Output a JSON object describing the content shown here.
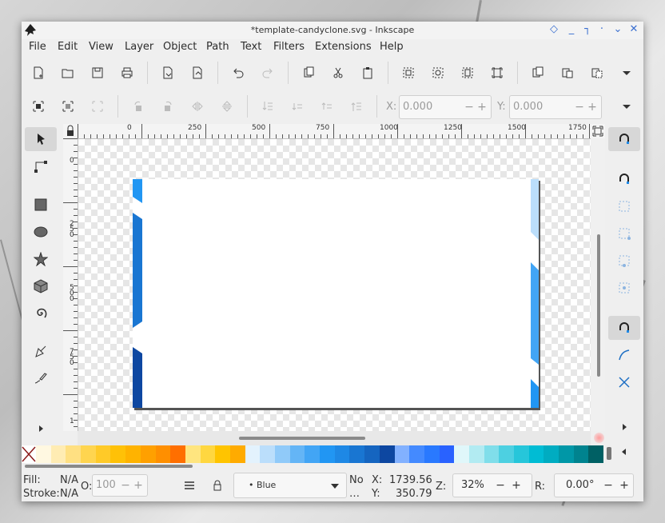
{
  "window": {
    "title": "*template-candyclone.svg - Inkscape",
    "controls": [
      "◇",
      "_",
      "┐",
      "·",
      "⌄",
      "✕"
    ]
  },
  "menu": [
    "File",
    "Edit",
    "View",
    "Layer",
    "Object",
    "Path",
    "Text",
    "Filters",
    "Extensions",
    "Help"
  ],
  "toolbar1": {
    "icons": [
      "new-document-icon",
      "open-icon",
      "save-icon",
      "print-icon",
      "import-icon",
      "export-icon",
      "undo-icon",
      "redo-icon",
      "copy-icon",
      "cut-icon",
      "paste-icon",
      "zoom-selection-icon",
      "zoom-drawing-icon",
      "zoom-page-icon",
      "zoom-page-width-icon",
      "duplicate-icon",
      "clone-icon",
      "unlink-clone-icon",
      "overflow-icon"
    ]
  },
  "toolbar2": {
    "icons": [
      "select-all-icon",
      "select-all-layers-icon",
      "deselect-icon",
      "rotate-ccw-icon",
      "rotate-cw-icon",
      "flip-horizontal-icon",
      "flip-vertical-icon",
      "lower-bottom-icon",
      "lower-icon",
      "raise-icon",
      "raise-top-icon",
      "overflow-icon"
    ],
    "x_label": "X:",
    "x_value": "0.000",
    "y_label": "Y:",
    "y_value": "0.000"
  },
  "tools": [
    "selector-icon",
    "node-editor-icon",
    "rectangle-icon",
    "ellipse-icon",
    "star-icon",
    "box-3d-icon",
    "spiral-icon",
    "pen-icon",
    "calligraphy-icon",
    "more-tools-icon"
  ],
  "ruler": {
    "h_labels": [
      "0",
      "250",
      "500",
      "750",
      "1000",
      "1250",
      "1500",
      "1750"
    ],
    "v_labels": [
      "0",
      "2 5 0",
      "5 0 0",
      "7 5 0",
      "1"
    ]
  },
  "snap": [
    "snap-toggle-icon",
    "snap-bbox-icon",
    "snap-bbox-edge-icon",
    "snap-bbox-corner-icon",
    "snap-bbox-midpoint-icon",
    "snap-bbox-center-icon",
    "snap-nodes-icon",
    "snap-path-icon",
    "snap-intersection-icon",
    "more-snap-icon",
    "palette-menu-icon"
  ],
  "palette": {
    "none_icon": "no-paint-icon",
    "colors": [
      "#fff8e1",
      "#ffecb3",
      "#ffe082",
      "#ffd54f",
      "#ffca28",
      "#ffc107",
      "#ffb300",
      "#ffa000",
      "#ff8f00",
      "#ff6f00",
      "#ffe57f",
      "#ffd740",
      "#ffc400",
      "#ffab00",
      "#e3f2fd",
      "#bbdefb",
      "#90caf9",
      "#64b5f6",
      "#42a5f5",
      "#2196f3",
      "#1e88e5",
      "#1976d2",
      "#1565c0",
      "#0d47a1",
      "#82b1ff",
      "#448aff",
      "#2979ff",
      "#2962ff",
      "#e0f7fa",
      "#b2ebf2",
      "#80deea",
      "#4dd0e1",
      "#26c6da",
      "#00bcd4",
      "#00acc1",
      "#0097a7",
      "#00838f",
      "#006064"
    ]
  },
  "status": {
    "fill_label": "Fill:",
    "fill_value": "N/A",
    "stroke_label": "Stroke:",
    "stroke_value": "N/A",
    "opacity_label": "O:",
    "opacity_value": "100",
    "layer": "• Blue",
    "no_label": "No",
    "ellipsis": "…",
    "x_label": "X:",
    "x_value": "1739.56",
    "y_label": "Y:",
    "y_value": "350.79",
    "zoom_label": "Z:",
    "zoom_value": "32%",
    "rotate_label": "R:",
    "rotate_value": "0.00°"
  }
}
